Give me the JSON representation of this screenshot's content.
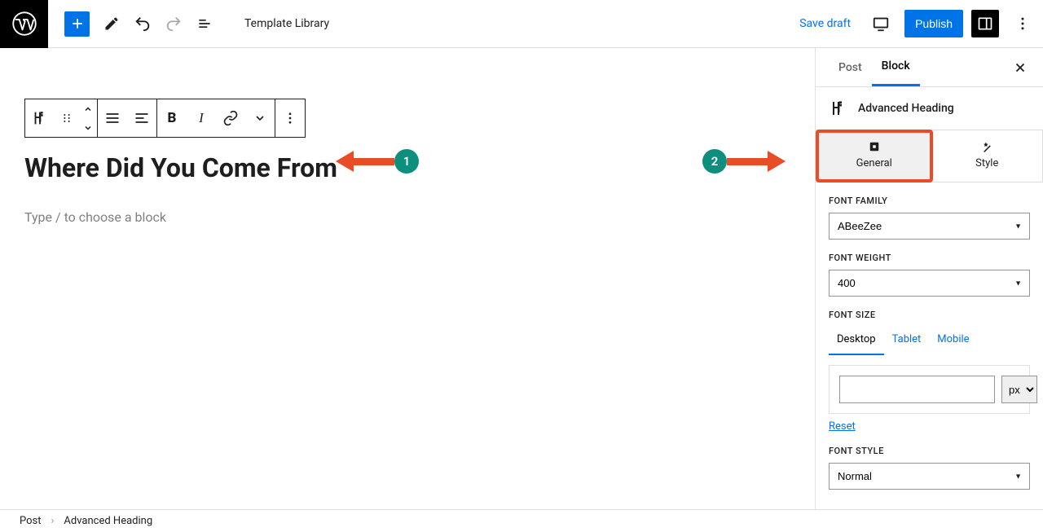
{
  "topbar": {
    "template_library": "Template Library",
    "save_draft": "Save draft",
    "publish": "Publish"
  },
  "editor": {
    "heading": "Where Did You Come From",
    "placeholder": "Type / to choose a block"
  },
  "sidebar": {
    "tabs": {
      "post": "Post",
      "block": "Block"
    },
    "block_name": "Advanced Heading",
    "subtabs": {
      "general": "General",
      "style": "Style"
    },
    "font_family": {
      "label": "FONT FAMILY",
      "value": "ABeeZee"
    },
    "font_weight": {
      "label": "FONT WEIGHT",
      "value": "400"
    },
    "font_size": {
      "label": "FONT SIZE",
      "devices": {
        "desktop": "Desktop",
        "tablet": "Tablet",
        "mobile": "Mobile"
      },
      "value": "",
      "unit": "px",
      "reset": "Reset"
    },
    "font_style": {
      "label": "FONT STYLE",
      "value": "Normal"
    }
  },
  "breadcrumb": {
    "root": "Post",
    "current": "Advanced Heading"
  },
  "annotations": {
    "one": "1",
    "two": "2"
  }
}
